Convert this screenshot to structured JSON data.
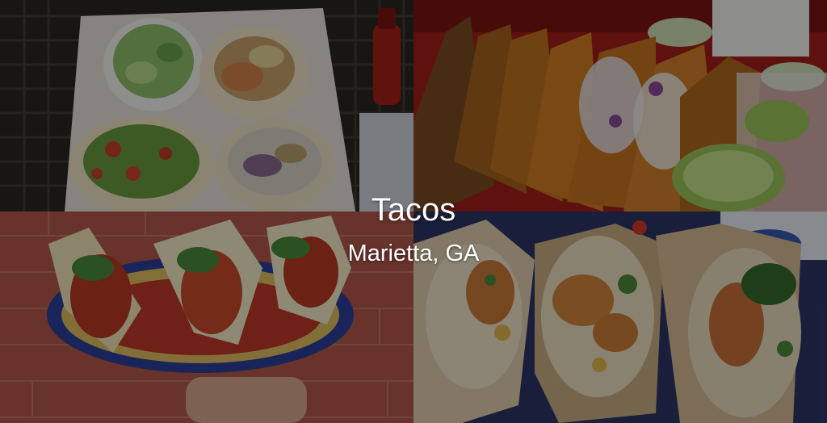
{
  "heading": {
    "title": "Tacos",
    "subtitle": "Marietta, GA"
  },
  "images": [
    {
      "name": "tacos-platter-with-salad-photo"
    },
    {
      "name": "row-of-crispy-tacos-photo"
    },
    {
      "name": "tacos-on-decorated-plate-photo"
    },
    {
      "name": "shrimp-tacos-closeup-photo"
    }
  ],
  "colors": {
    "overlay": "rgba(0,0,0,0.42)",
    "text": "#ffffff"
  }
}
